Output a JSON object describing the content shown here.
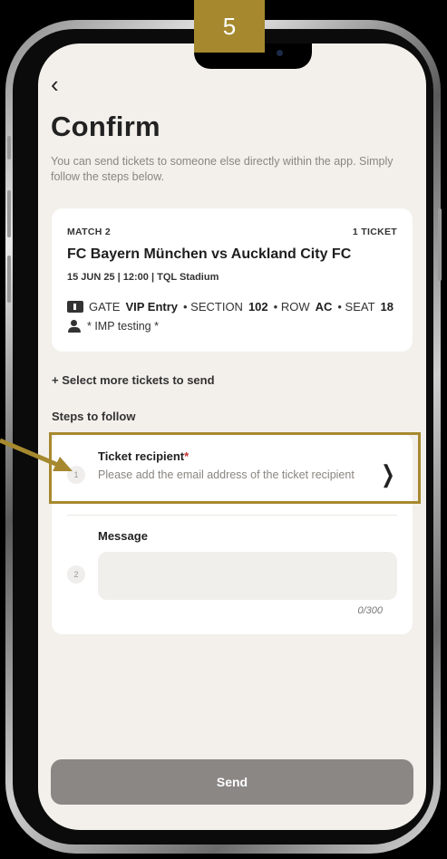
{
  "annotation": {
    "step_number": "5",
    "accent_color": "#a6892f"
  },
  "header": {
    "back_icon": "chevron-left",
    "title": "Confirm",
    "subtitle": "You can send tickets to someone else directly within the app. Simply follow the steps below."
  },
  "ticket": {
    "match_label": "MATCH 2",
    "ticket_count": "1 TICKET",
    "match_title": "FC Bayern München vs Auckland City FC",
    "date_venue": "15 JUN 25 | 12:00 | TQL Stadium",
    "gate_prefix": "GATE",
    "gate_value": "VIP Entry",
    "section_prefix": "• SECTION",
    "section_value": "102",
    "row_prefix": "• ROW",
    "row_value": "AC",
    "seat_prefix": "• SEAT",
    "seat_value": "18",
    "holder": "* IMP testing  *"
  },
  "select_more": "+ Select more tickets to send",
  "steps_heading": "Steps to follow",
  "steps": {
    "recipient": {
      "number": "1",
      "label": "Ticket recipient",
      "required_mark": "*",
      "description": "Please add the email address of the ticket recipient"
    },
    "message": {
      "number": "2",
      "label": "Message",
      "value": "",
      "char_count": "0/300"
    }
  },
  "send_label": "Send"
}
